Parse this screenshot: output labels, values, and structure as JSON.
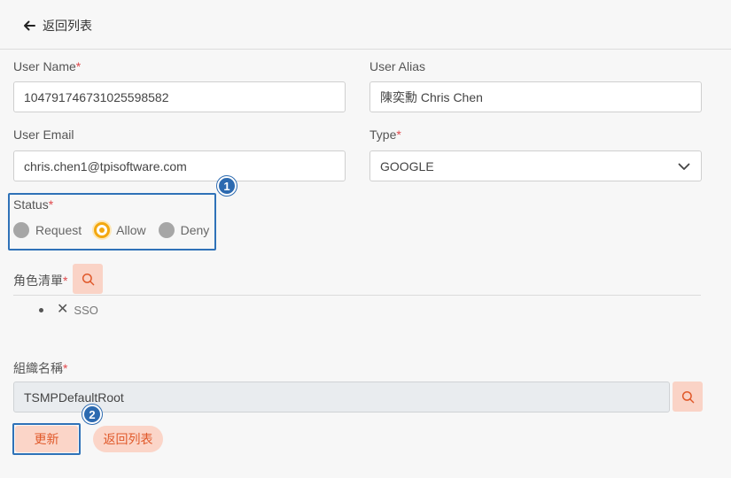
{
  "header": {
    "back_label": "返回列表"
  },
  "form": {
    "user_name": {
      "label": "User Name",
      "required": "*",
      "value": "104791746731025598582"
    },
    "user_alias": {
      "label": "User Alias",
      "value": "陳奕勳 Chris Chen"
    },
    "user_email": {
      "label": "User Email",
      "value": "chris.chen1@tpisoftware.com"
    },
    "type": {
      "label": "Type",
      "required": "*",
      "value": "GOOGLE"
    },
    "status": {
      "label": "Status",
      "required": "*",
      "options": [
        "Request",
        "Allow",
        "Deny"
      ],
      "selected": "Allow"
    },
    "roles": {
      "label": "角色清單",
      "required": "*",
      "items": [
        "SSO"
      ]
    },
    "org": {
      "label": "組織名稱",
      "required": "*",
      "value": "TSMPDefaultRoot"
    }
  },
  "actions": {
    "update_label": "更新",
    "back_label": "返回列表"
  },
  "annotations": {
    "badge1": "1",
    "badge2": "2"
  },
  "colors": {
    "accent": "#f3a80f",
    "button_bg": "#fbd5c8",
    "button_text": "#e0592a",
    "highlight": "#2f72b8"
  }
}
